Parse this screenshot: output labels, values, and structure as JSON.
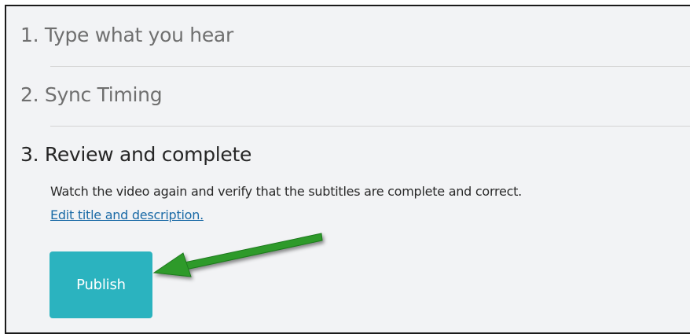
{
  "steps": [
    {
      "label": "1. Type what you hear"
    },
    {
      "label": "2. Sync Timing"
    },
    {
      "label": "3. Review and complete"
    }
  ],
  "review": {
    "description": "Watch the video again and verify that the subtitles are complete and correct.",
    "edit_link": "Edit title and description."
  },
  "publish_button": {
    "label": "Publish"
  },
  "colors": {
    "background": "#f2f3f5",
    "publish_button": "#2bb3bf",
    "link": "#1a6aa6",
    "annotation_arrow": "#2e9a2a"
  },
  "annotation": {
    "icon": "arrow-left-icon"
  }
}
